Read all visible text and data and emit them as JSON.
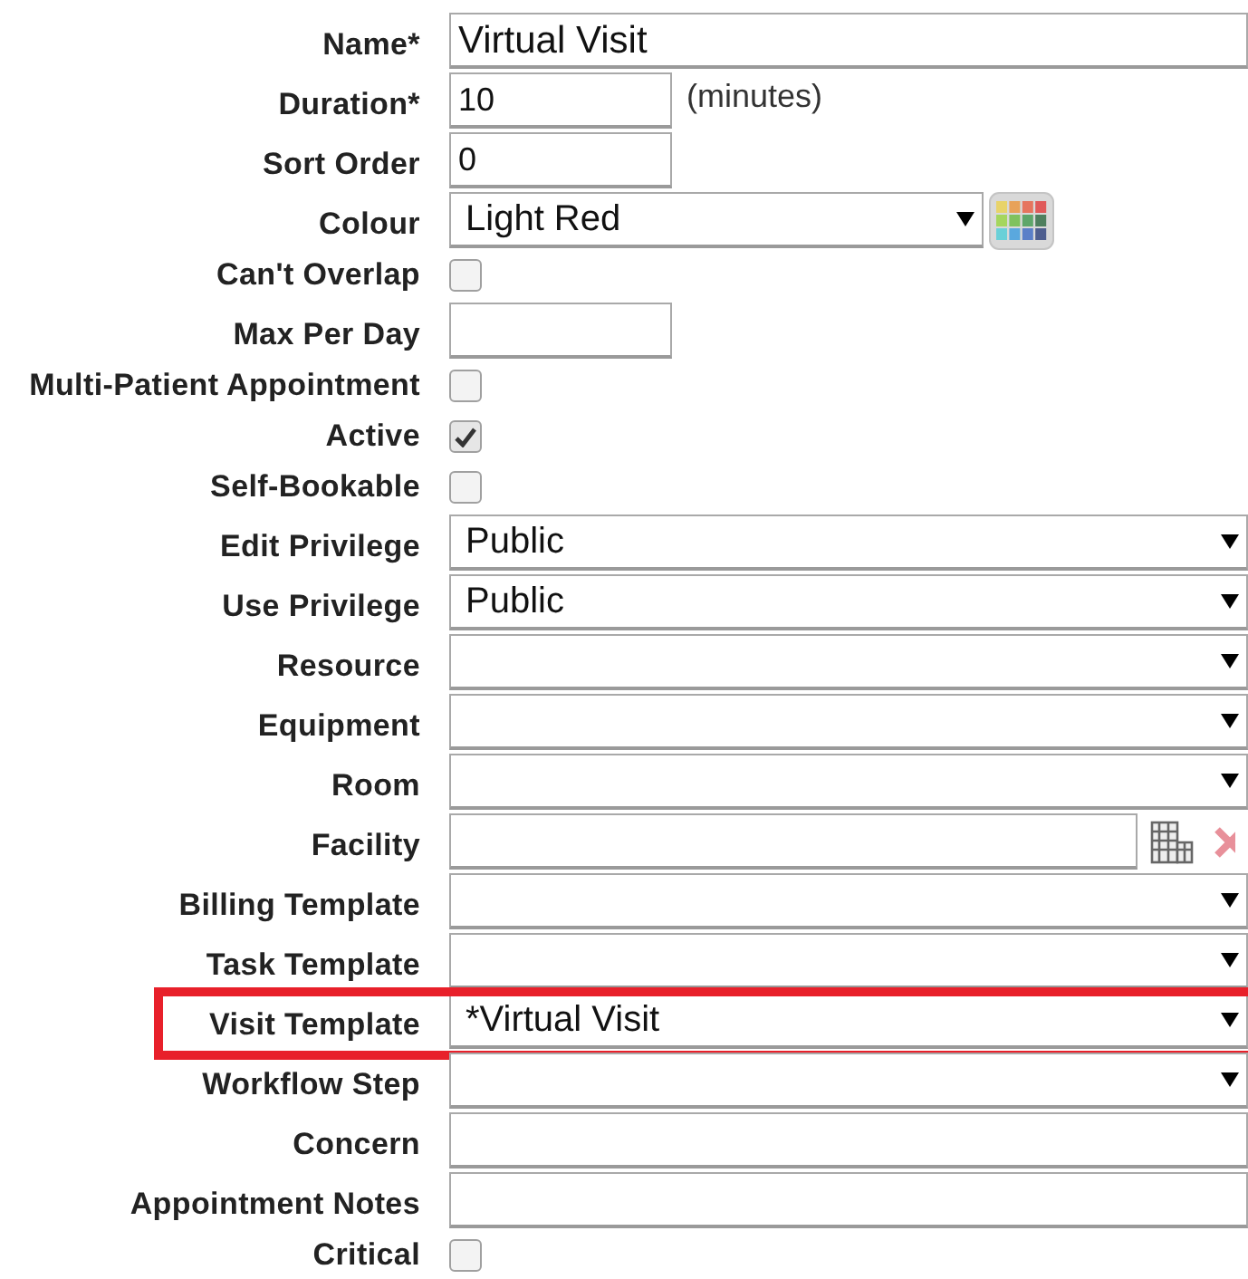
{
  "fields": [
    {
      "kind": "text",
      "label": "Name*",
      "value": "Virtual Visit",
      "highlighted": false
    },
    {
      "kind": "short",
      "label": "Duration*",
      "value": "10",
      "suffix": "(minutes)",
      "highlighted": false
    },
    {
      "kind": "short",
      "label": "Sort Order",
      "value": "0",
      "highlighted": false
    },
    {
      "kind": "colour",
      "label": "Colour",
      "value": "Light Red",
      "highlighted": false
    },
    {
      "kind": "checkbox",
      "label": "Can't Overlap",
      "checked": false,
      "highlighted": false
    },
    {
      "kind": "short",
      "label": "Max Per Day",
      "highlighted": false
    },
    {
      "kind": "checkbox",
      "label": "Multi-Patient Appointment",
      "checked": false,
      "highlighted": false
    },
    {
      "kind": "checkbox",
      "label": "Active",
      "checked": true,
      "highlighted": false
    },
    {
      "kind": "checkbox",
      "label": "Self-Bookable",
      "checked": false,
      "highlighted": false
    },
    {
      "kind": "select",
      "label": "Edit Privilege",
      "value": "Public",
      "highlighted": false
    },
    {
      "kind": "select",
      "label": "Use Privilege",
      "value": "Public",
      "highlighted": false
    },
    {
      "kind": "select",
      "label": "Resource",
      "highlighted": false
    },
    {
      "kind": "select",
      "label": "Equipment",
      "highlighted": false
    },
    {
      "kind": "select",
      "label": "Room",
      "highlighted": false
    },
    {
      "kind": "facility",
      "label": "Facility",
      "highlighted": false
    },
    {
      "kind": "select",
      "label": "Billing Template",
      "highlighted": false
    },
    {
      "kind": "select",
      "label": "Task Template",
      "highlighted": false
    },
    {
      "kind": "select",
      "label": "Visit Template",
      "value": "*Virtual Visit",
      "highlighted": true
    },
    {
      "kind": "select",
      "label": "Workflow Step",
      "highlighted": false
    },
    {
      "kind": "text",
      "label": "Concern",
      "highlighted": false
    },
    {
      "kind": "text",
      "label": "Appointment Notes",
      "highlighted": false
    },
    {
      "kind": "checkbox",
      "label": "Critical",
      "checked": false,
      "highlighted": false
    }
  ]
}
